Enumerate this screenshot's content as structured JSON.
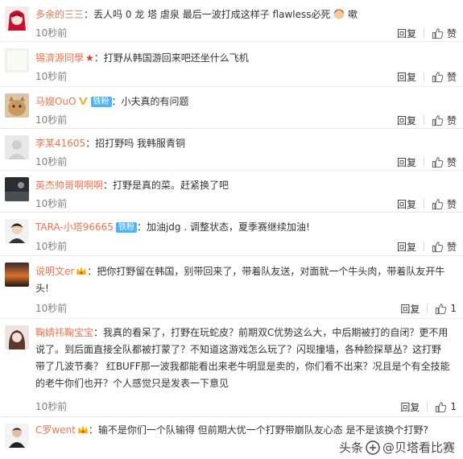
{
  "comments": [
    {
      "user": "多余的三三",
      "text": "丢人吗 0 龙 塔 虐泉 最后一波打成这样子 flawless必死",
      "text_tail": "嗽",
      "time": "10秒前",
      "reply": "回复",
      "like": "赞",
      "avatar": "red-hair-anime-avatar"
    },
    {
      "user": "锡濟源同學",
      "text": "打野从韩国游回来吧还坐什么飞机",
      "time": "10秒前",
      "reply": "回复",
      "like": "赞",
      "avatar": "pale-avatar"
    },
    {
      "user": "马嫂OuO",
      "fan_badge": "铁粉",
      "text": "小夫真的有问题",
      "time": "10秒前",
      "reply": "回复",
      "like": "赞",
      "avatar": "cat-avatar"
    },
    {
      "user": "李某41605",
      "text": "招打野吗 我韩服青铜",
      "time": "10秒前",
      "reply": "回复",
      "like": "赞",
      "avatar": "default-avatar"
    },
    {
      "user": "英杰帅哥啊啊啊",
      "text": "打野是真的菜。赶紧换了吧",
      "time": "10秒前",
      "reply": "回复",
      "like": "赞",
      "avatar": "dark-scene-avatar"
    },
    {
      "user": "TARA-小塔96665",
      "fan_badge": "铁粉",
      "text": "加油jdg . 调整状态，夏季赛继续加油!",
      "time": "10秒前",
      "reply": "回复",
      "like": "赞",
      "avatar": "boy-avatar"
    },
    {
      "user": "说明文er",
      "text": "把你打野留在韩国，别带回来了，带着队友送，对面就一个牛头肉，带着队友开牛头!",
      "time": "10秒前",
      "reply": "回复",
      "like_count": "1",
      "avatar": "sunset-avatar"
    },
    {
      "user": "鞠婧祎鞠宝宝",
      "text": "我真的看呆了，打野在玩蛇皮？前期双C优势这么大，中后期被打的自闭？更不用说了。到后面直接全队都被打蒙了？不知道这游戏怎么玩了？闪现撞墙，各种脸探草丛？这打野带了几波节奏？ 红BUFF那一波我都能看出来老牛明显是卖的，你们看不出来？况且是个有全技能的老牛你们也开？个人感觉只是发表一下意见",
      "time": "10秒前",
      "reply": "回复",
      "like_count": "1",
      "avatar": "girl-avatar"
    },
    {
      "user": "C罗went",
      "text": "输不是你们一个队输得 但前期大优一个打野带崩队友心态 是不是该换个打野?",
      "avatar": "player-avatar"
    }
  ],
  "watermark": {
    "prefix": "头条",
    "handle": "@贝塔看比赛"
  },
  "colors": {
    "username": "#eb7350",
    "fan_badge": "#4fb4f5",
    "time": "#808080"
  }
}
